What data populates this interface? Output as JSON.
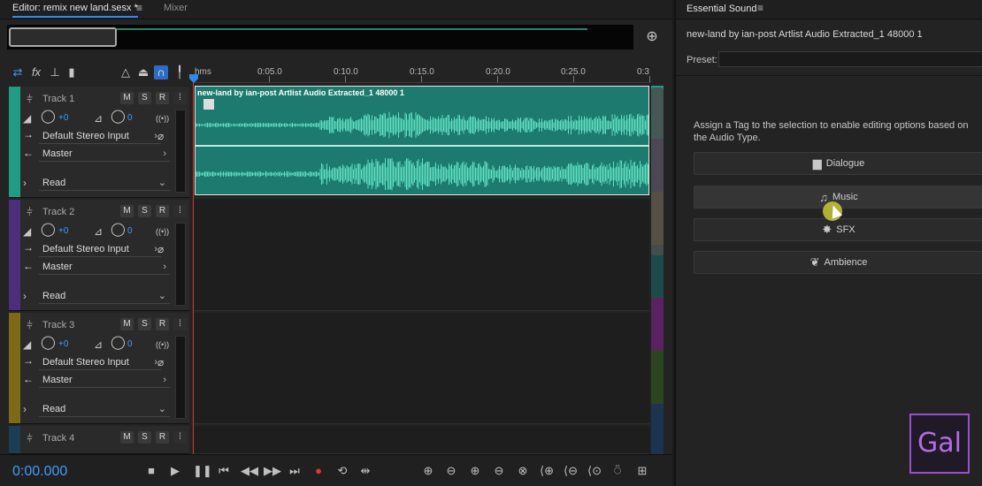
{
  "editor": {
    "tab_editor": "Editor: remix new land.sesx *",
    "tab_editor_menu": "≡",
    "tab_mixer": "Mixer"
  },
  "ruler": {
    "labels": [
      "hms",
      "0:05.0",
      "0:10.0",
      "0:15.0",
      "0:20.0",
      "0:25.0",
      "0:3"
    ]
  },
  "tracks": [
    {
      "name": "Track 1",
      "volume": "+0",
      "pan": "0",
      "input": "Default Stereo Input",
      "output": "Master",
      "automation": "Read",
      "color": "#1f9c83"
    },
    {
      "name": "Track 2",
      "volume": "+0",
      "pan": "0",
      "input": "Default Stereo Input",
      "output": "Master",
      "automation": "Read",
      "color": "#4b2f7c"
    },
    {
      "name": "Track 3",
      "volume": "+0",
      "pan": "0",
      "input": "Default Stereo Input",
      "output": "Master",
      "automation": "Read",
      "color": "#7d6a16"
    },
    {
      "name": "Track 4",
      "color": "#1d3d55"
    }
  ],
  "track_buttons": {
    "mute": "M",
    "solo": "S",
    "record": "R"
  },
  "clip": {
    "title": "new-land by ian-post Artlist Audio Extracted_1 48000 1"
  },
  "transport": {
    "timecode": "0:00.000"
  },
  "essential_sound": {
    "title": "Essential Sound",
    "menu": "≡",
    "clip_name": "new-land by ian-post Artlist Audio Extracted_1 48000 1",
    "preset_label": "Preset:",
    "instructions": "Assign a Tag to the selection to enable editing options based on the Audio Type.",
    "buttons": [
      {
        "label": "Dialogue",
        "icon": "speech-bubble-icon"
      },
      {
        "label": "Music",
        "icon": "music-note-icon"
      },
      {
        "label": "SFX",
        "icon": "burst-icon"
      },
      {
        "label": "Ambience",
        "icon": "leaf-icon"
      }
    ]
  },
  "watermark": {
    "text": "Gal"
  }
}
